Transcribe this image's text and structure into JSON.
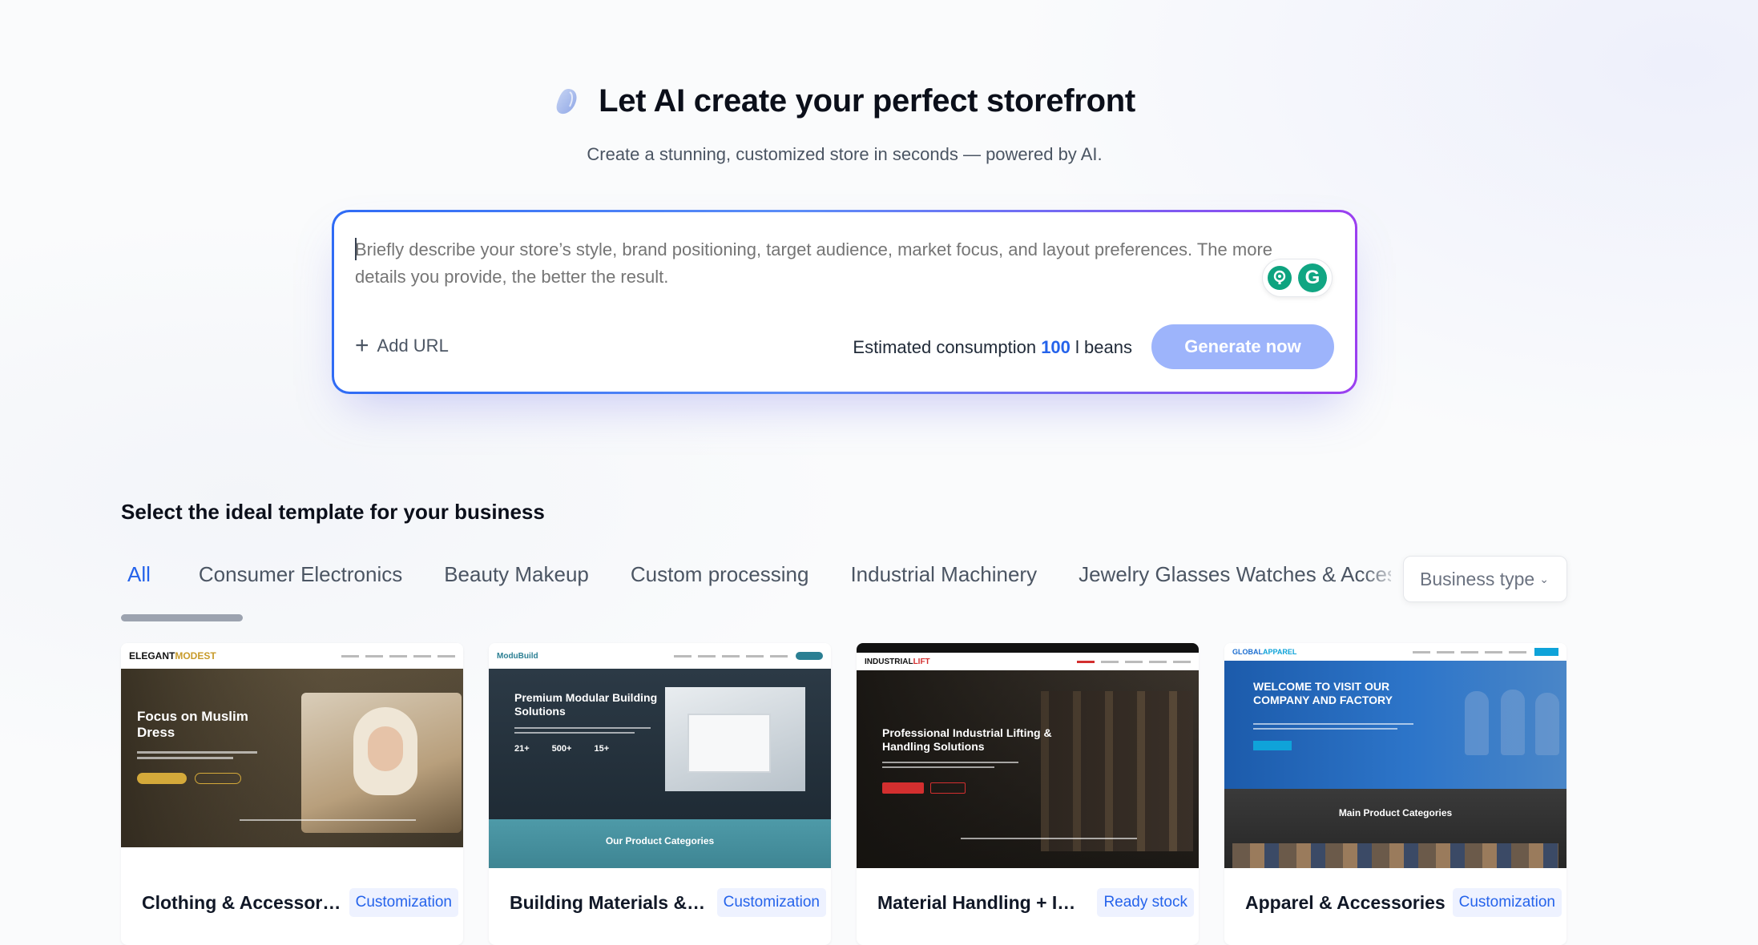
{
  "hero": {
    "title": "Let AI create your perfect storefront",
    "subtitle": "Create a stunning, customized store in seconds — powered by AI."
  },
  "prompt": {
    "placeholder": "Briefly describe your store’s style, brand positioning, target audience, market focus, and layout preferences. The more details you provide, the better the result.",
    "add_url_label": "Add URL",
    "consumption_prefix": "Estimated consumption",
    "consumption_value": "100",
    "consumption_suffix": "beans",
    "generate_label": "Generate now"
  },
  "templates": {
    "section_title": "Select the ideal template for your business",
    "tabs": [
      {
        "label": "All",
        "active": true
      },
      {
        "label": "Consumer Electronics"
      },
      {
        "label": "Beauty Makeup"
      },
      {
        "label": "Custom processing"
      },
      {
        "label": "Industrial Machinery"
      },
      {
        "label": "Jewelry Glasses Watches & Accessories"
      }
    ],
    "business_type_label": "Business type",
    "cards": [
      {
        "title": "Clothing & Accessories",
        "tag": "Customization",
        "brand_a": "ELEGANT",
        "brand_b": "MODEST",
        "hero": "Focus on Muslim Dress"
      },
      {
        "title": "Building Materials & Hardware",
        "tag": "Customization",
        "brand_a": "ModuBuild",
        "hero": "Premium Modular Building Solutions",
        "stats": [
          "21+",
          "500+",
          "15+"
        ],
        "footer": "Our Product Categories"
      },
      {
        "title": "Material Handling + Industrial Equipment",
        "tag": "Ready stock",
        "brand_a": "INDUSTRIAL",
        "brand_b": "LIFT",
        "hero": "Professional Industrial Lifting & Handling Solutions"
      },
      {
        "title": "Apparel & Accessories",
        "tag": "Customization",
        "brand_a": "GLOBAL",
        "brand_b": "APPAREL",
        "hero": "WELCOME TO VISIT OUR COMPANY AND FACTORY",
        "footer": "Main Product Categories"
      }
    ]
  },
  "colors": {
    "accent": "#2563eb",
    "generate_disabled": "#9db4fb",
    "tag_bg": "#eef2ff"
  }
}
